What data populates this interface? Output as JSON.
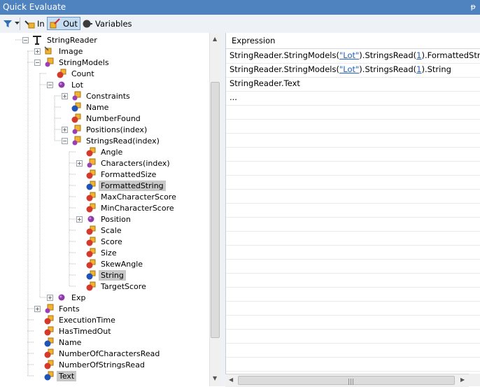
{
  "window": {
    "title": "Quick Evaluate",
    "pin_glyph": "ᵽ"
  },
  "toolbar": {
    "filter_icon": "filter-icon",
    "in_label": "In",
    "out_label": "Out",
    "variables_label": "Variables"
  },
  "tree": [
    {
      "label": "StringReader",
      "level": 0,
      "expander": "minus",
      "icon": "reader",
      "selected": false
    },
    {
      "label": "Image",
      "level": 1,
      "expander": "plus",
      "icon": "image",
      "selected": false
    },
    {
      "label": "StringModels",
      "level": 1,
      "expander": "minus",
      "icon": "collection",
      "selected": false
    },
    {
      "label": "Count",
      "level": 2,
      "expander": "none",
      "icon": "prop-red",
      "selected": false
    },
    {
      "label": "Lot",
      "level": 2,
      "expander": "minus",
      "icon": "object",
      "selected": false
    },
    {
      "label": "Constraints",
      "level": 3,
      "expander": "plus",
      "icon": "collection",
      "selected": false
    },
    {
      "label": "Name",
      "level": 3,
      "expander": "none",
      "icon": "prop-blue",
      "selected": false
    },
    {
      "label": "NumberFound",
      "level": 3,
      "expander": "none",
      "icon": "prop-red",
      "selected": false
    },
    {
      "label": "Positions(index)",
      "level": 3,
      "expander": "plus",
      "icon": "collection",
      "selected": false
    },
    {
      "label": "StringsRead(index)",
      "level": 3,
      "expander": "minus",
      "icon": "collection",
      "selected": false
    },
    {
      "label": "Angle",
      "level": 4,
      "expander": "none",
      "icon": "prop-red",
      "selected": false
    },
    {
      "label": "Characters(index)",
      "level": 4,
      "expander": "plus",
      "icon": "collection",
      "selected": false
    },
    {
      "label": "FormattedSize",
      "level": 4,
      "expander": "none",
      "icon": "prop-red",
      "selected": false
    },
    {
      "label": "FormattedString",
      "level": 4,
      "expander": "none",
      "icon": "prop-blue",
      "selected": true
    },
    {
      "label": "MaxCharacterScore",
      "level": 4,
      "expander": "none",
      "icon": "prop-red",
      "selected": false
    },
    {
      "label": "MinCharacterScore",
      "level": 4,
      "expander": "none",
      "icon": "prop-red",
      "selected": false
    },
    {
      "label": "Position",
      "level": 4,
      "expander": "plus",
      "icon": "object",
      "selected": false
    },
    {
      "label": "Scale",
      "level": 4,
      "expander": "none",
      "icon": "prop-red",
      "selected": false
    },
    {
      "label": "Score",
      "level": 4,
      "expander": "none",
      "icon": "prop-red",
      "selected": false
    },
    {
      "label": "Size",
      "level": 4,
      "expander": "none",
      "icon": "prop-red",
      "selected": false
    },
    {
      "label": "SkewAngle",
      "level": 4,
      "expander": "none",
      "icon": "prop-red",
      "selected": false
    },
    {
      "label": "String",
      "level": 4,
      "expander": "none",
      "icon": "prop-blue",
      "selected": true
    },
    {
      "label": "TargetScore",
      "level": 4,
      "expander": "none",
      "icon": "prop-red",
      "selected": false
    },
    {
      "label": "Exp",
      "level": 2,
      "expander": "plus",
      "icon": "object",
      "selected": false
    },
    {
      "label": "Fonts",
      "level": 1,
      "expander": "plus",
      "icon": "collection",
      "selected": false
    },
    {
      "label": "ExecutionTime",
      "level": 1,
      "expander": "none",
      "icon": "prop-red",
      "selected": false
    },
    {
      "label": "HasTimedOut",
      "level": 1,
      "expander": "none",
      "icon": "prop-red",
      "selected": false
    },
    {
      "label": "Name",
      "level": 1,
      "expander": "none",
      "icon": "prop-blue",
      "selected": false
    },
    {
      "label": "NumberOfCharactersRead",
      "level": 1,
      "expander": "none",
      "icon": "prop-red",
      "selected": false
    },
    {
      "label": "NumberOfStringsRead",
      "level": 1,
      "expander": "none",
      "icon": "prop-red",
      "selected": false
    },
    {
      "label": "Text",
      "level": 1,
      "expander": "none",
      "icon": "prop-blue",
      "selected": true
    }
  ],
  "expressions": {
    "header": "Expression",
    "rows": [
      {
        "pre": "StringReader.StringModels(",
        "link1": "\"Lot\"",
        "mid": ").StringsRead(",
        "link2": "1",
        "post": ").FormattedString"
      },
      {
        "pre": "StringReader.StringModels(",
        "link1": "\"Lot\"",
        "mid": ").StringsRead(",
        "link2": "1",
        "post": ").String"
      },
      {
        "pre": "StringReader.Text",
        "link1": "",
        "mid": "",
        "link2": "",
        "post": ""
      },
      {
        "pre": "...",
        "link1": "",
        "mid": "",
        "link2": "",
        "post": ""
      }
    ],
    "empty_rows": 20
  },
  "colors": {
    "titlebar": "#4f83c0",
    "selection": "#c8c8c8",
    "link": "#1f5fbf"
  }
}
